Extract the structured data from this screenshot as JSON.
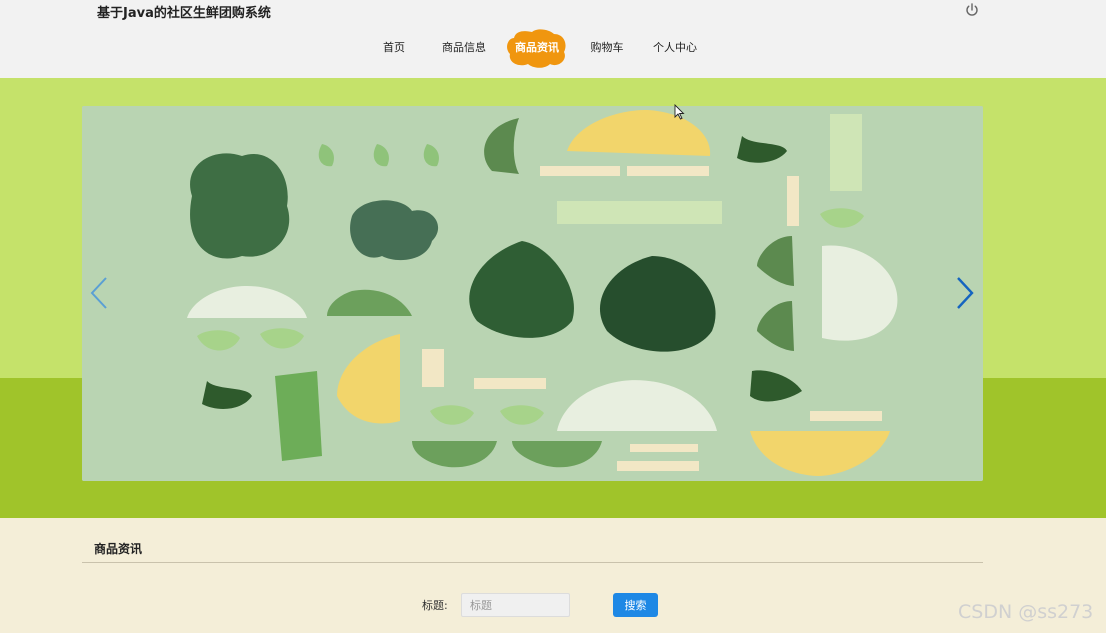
{
  "header": {
    "title": "基于Java的社区生鲜团购系统",
    "power_icon": "power-icon"
  },
  "nav": {
    "items": [
      {
        "label": "首页"
      },
      {
        "label": "商品信息"
      },
      {
        "label": "商品资讯",
        "active": true
      },
      {
        "label": "购物车"
      },
      {
        "label": "个人中心"
      }
    ],
    "active_color": "#f0960f"
  },
  "carousel": {
    "prev_icon": "chevron-left-icon",
    "next_icon": "chevron-right-icon"
  },
  "section": {
    "title": "商品资讯"
  },
  "search": {
    "label": "标题:",
    "placeholder": "标题",
    "button_label": "搜索",
    "button_color": "#1e88e5"
  },
  "watermark": "CSDN @ss273",
  "colors": {
    "banner_light": "#c5e26a",
    "banner_dark": "#a0c42a",
    "accent": "#f0960f"
  }
}
